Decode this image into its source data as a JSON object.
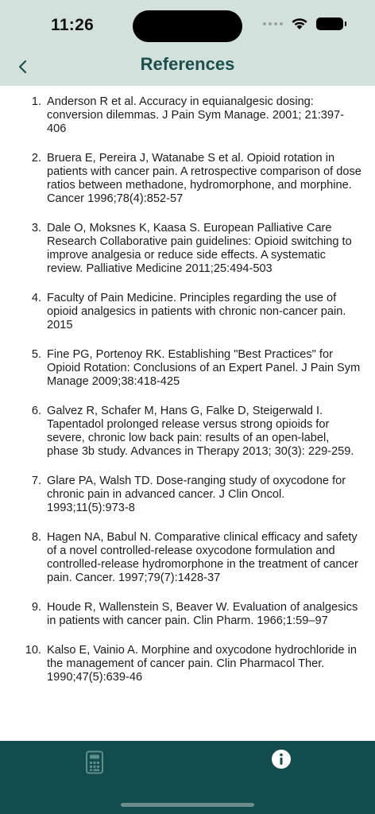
{
  "status_bar": {
    "time": "11:26"
  },
  "nav": {
    "title": "References"
  },
  "references": [
    {
      "num": "1.",
      "text": "Anderson R et al. Accuracy in equianalgesic dosing: conversion dilemmas. J Pain Sym Manage. 2001; 21:397-406"
    },
    {
      "num": "2.",
      "text": "Bruera E, Pereira J, Watanabe S et al. Opioid rotation in patients with cancer pain. A retrospective comparison of dose ratios between methadone, hydromorphone, and morphine. Cancer 1996;78(4):852-57"
    },
    {
      "num": "3.",
      "text": "Dale O, Moksnes K, Kaasa S. European Palliative Care Research Collaborative pain guidelines: Opioid switching to improve analgesia or reduce side effects. A systematic review. Palliative Medicine 2011;25:494-503"
    },
    {
      "num": "4.",
      "text": "Faculty of Pain Medicine. Principles regarding the use of opioid analgesics in patients with chronic non-cancer pain. 2015"
    },
    {
      "num": "5.",
      "text": "Fine PG, Portenoy RK. Establishing \"Best Practices\" for Opioid Rotation: Conclusions of an Expert Panel. J Pain Sym Manage 2009;38:418-425"
    },
    {
      "num": "6.",
      "text": "Galvez R, Schafer M, Hans G, Falke D, Steigerwald I. Tapentadol prolonged release versus strong opioids for severe, chronic low back pain: results of an open-label, phase 3b study. Advances in Therapy 2013; 30(3): 229-259."
    },
    {
      "num": "7.",
      "text": "Glare PA, Walsh TD. Dose-ranging study of oxycodone for chronic pain in advanced cancer. J Clin Oncol. 1993;11(5):973-8"
    },
    {
      "num": "8.",
      "text": "Hagen NA, Babul N. Comparative clinical efficacy and safety of a novel controlled-release oxycodone formulation and controlled-release hydromorphone in the treatment of cancer pain. Cancer. 1997;79(7):1428-37"
    },
    {
      "num": "9.",
      "text": "Houde R, Wallenstein S, Beaver W. Evaluation of analgesics in patients with cancer pain. Clin Pharm. 1966;1:59–97"
    },
    {
      "num": "10.",
      "text": "Kalso E, Vainio A. Morphine and oxycodone hydrochloride in the management of cancer pain. Clin Pharmacol Ther. 1990;47(5):639-46"
    }
  ],
  "tabbar": {
    "tabs": [
      {
        "icon": "calculator-icon"
      },
      {
        "icon": "info-icon"
      }
    ]
  },
  "colors": {
    "header_bg": "#d3e1dc",
    "title_text": "#1e4f4b",
    "tabbar_bg": "#124c4c"
  }
}
